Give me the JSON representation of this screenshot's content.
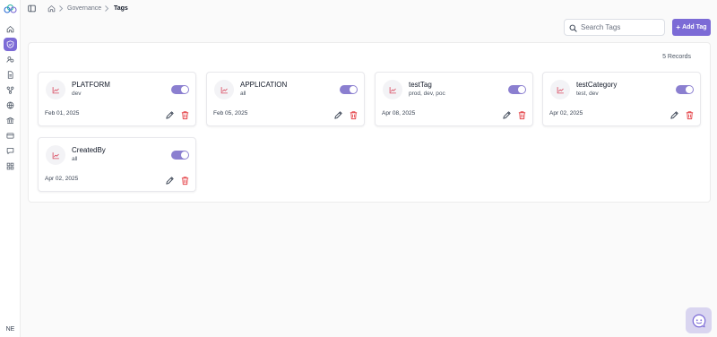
{
  "app": {
    "brand_color": "#7c6bd6"
  },
  "rail": {
    "items": [
      {
        "icon": "home-icon"
      },
      {
        "icon": "shield-icon",
        "active": true
      },
      {
        "icon": "users-icon"
      },
      {
        "icon": "document-icon"
      },
      {
        "icon": "workflow-icon"
      },
      {
        "icon": "globe-icon"
      },
      {
        "icon": "bank-icon"
      },
      {
        "icon": "card-icon"
      },
      {
        "icon": "chat-icon"
      },
      {
        "icon": "grid-icon"
      }
    ],
    "user_initials": "NE"
  },
  "breadcrumb": {
    "items": [
      "Governance",
      "Tags"
    ]
  },
  "toolbar": {
    "search_placeholder": "Search Tags",
    "add_label": "Add Tag",
    "add_plus": "+"
  },
  "records_label": "5 Records",
  "tags": [
    {
      "name": "PLATFORM",
      "environments": "dev",
      "date": "Feb 01, 2025",
      "enabled": true
    },
    {
      "name": "APPLICATION",
      "environments": "all",
      "date": "Feb 05, 2025",
      "enabled": true
    },
    {
      "name": "testTag",
      "environments": "prod, dev, poc",
      "date": "Apr 08, 2025",
      "enabled": true
    },
    {
      "name": "testCategory",
      "environments": "test, dev",
      "date": "Apr 02, 2025",
      "enabled": true
    },
    {
      "name": "CreatedBy",
      "environments": "all",
      "date": "Apr 02, 2025",
      "enabled": true
    }
  ],
  "colors": {
    "accent": "#7c6bd6",
    "toggle_on": "#8b7fd0",
    "delete": "#e5484d",
    "tag_icon": "#d9465c"
  }
}
